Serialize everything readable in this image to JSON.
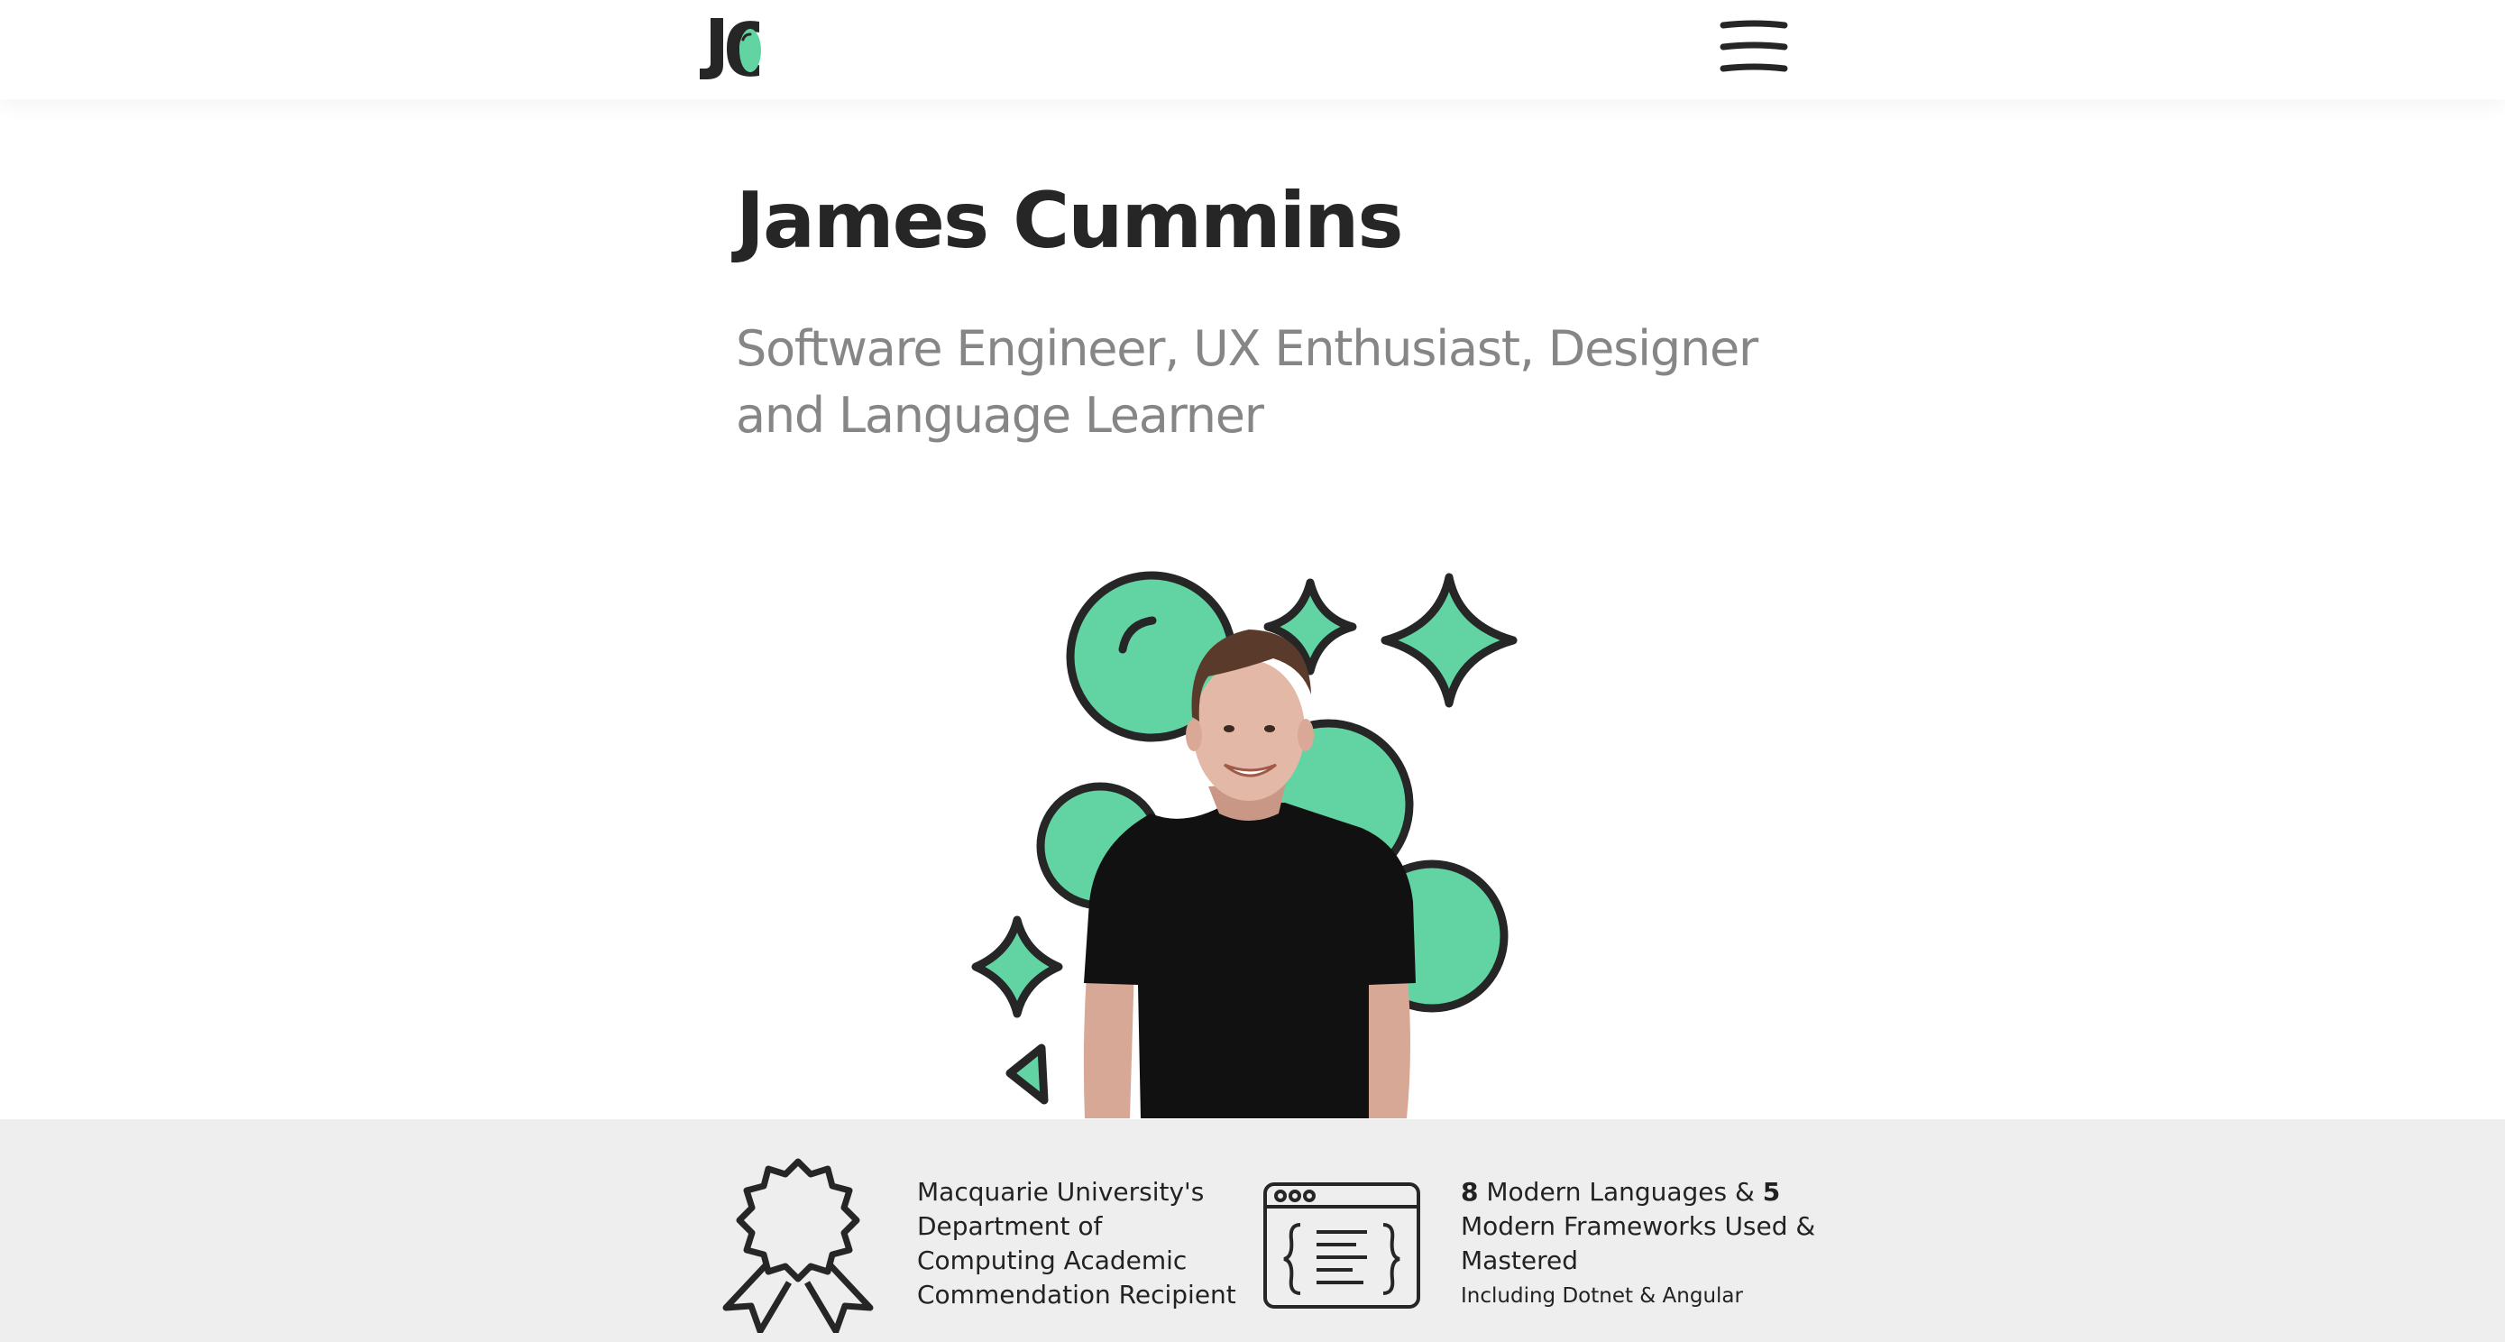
{
  "brand": {
    "logo_icon": "jc-monogram-logo",
    "accent_color": "#62d3a2",
    "dark_color": "#262626"
  },
  "nav": {
    "menu_icon": "hamburger-menu-icon"
  },
  "hero": {
    "title": "James Cummins",
    "subtitle": "Software Engineer, UX Enthusiast, Designer and Language Learner"
  },
  "illustration": {
    "icons": [
      "bubble-icon",
      "sparkle-icon",
      "person-photo"
    ]
  },
  "stats": {
    "background_color": "#eeeeee",
    "award": {
      "icon": "award-rosette-icon",
      "text": "Macquarie University's Department of Computing Academic Commendation Recipient"
    },
    "skills": {
      "icon": "code-window-icon",
      "languages_count": "8",
      "languages_label": "Modern Languages &",
      "frameworks_count": "5",
      "frameworks_label": "Modern Frameworks Used & Mastered",
      "note": "Including Dotnet & Angular"
    }
  }
}
